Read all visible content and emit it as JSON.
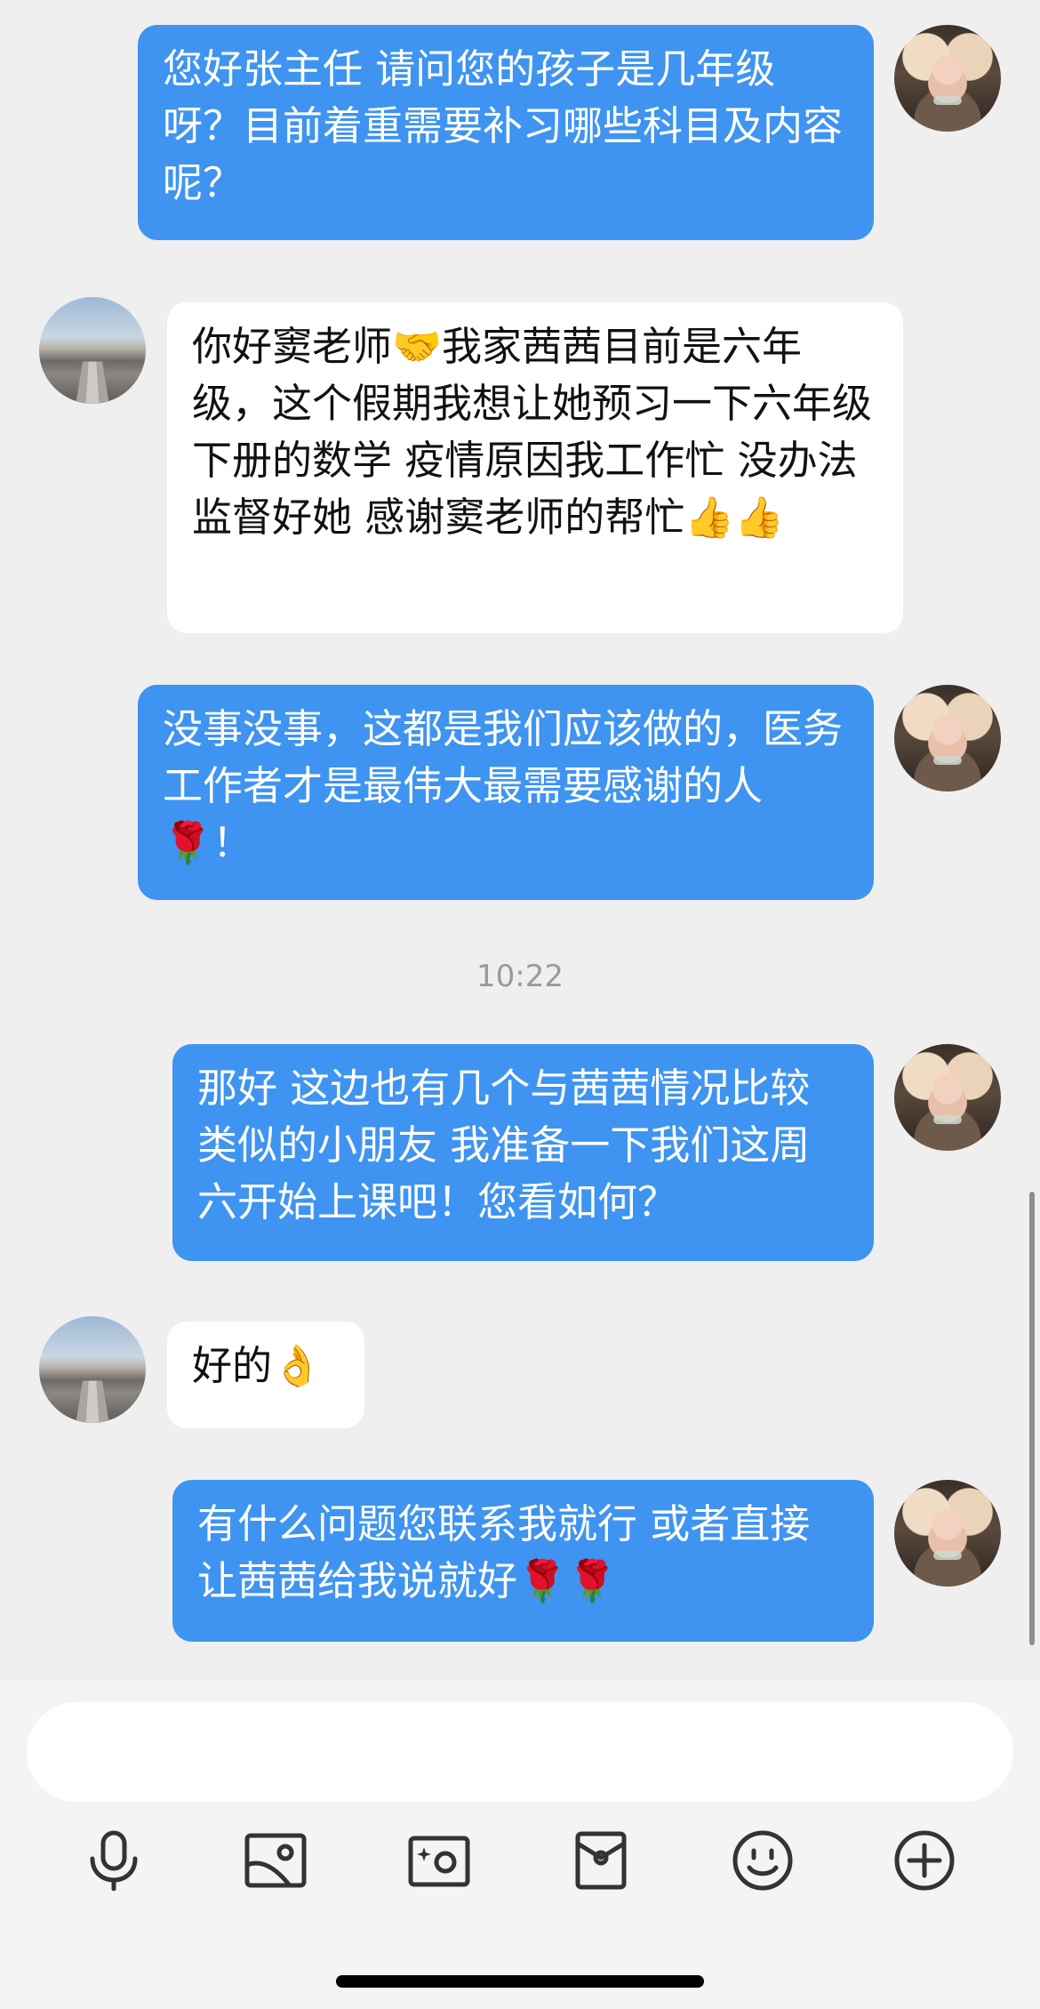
{
  "messages": [
    {
      "sender": "teacher",
      "text": "您好张主任 请问您的孩子是几年级呀？目前着重需要补习哪些科目及内容呢？"
    },
    {
      "sender": "parent",
      "text": "你好窦老师🤝我家茜茜目前是六年级，这个假期我想让她预习一下六年级下册的数学 疫情原因我工作忙 没办法监督好她 感谢窦老师的帮忙👍👍"
    },
    {
      "sender": "teacher",
      "text": "没事没事，这都是我们应该做的，医务工作者才是最伟大最需要感谢的人🌹！"
    },
    {
      "sender": "teacher",
      "text": "那好 这边也有几个与茜茜情况比较类似的小朋友 我准备一下我们这周六开始上课吧！您看如何？"
    },
    {
      "sender": "parent",
      "text": "好的👌"
    },
    {
      "sender": "teacher",
      "text": "有什么问题您联系我就行 或者直接让茜茜给我说就好🌹🌹"
    }
  ],
  "timestamp": "10:22",
  "composer": {
    "input_value": "",
    "tools": [
      "microphone-icon",
      "image-icon",
      "camera-icon",
      "red-packet-icon",
      "emoji-icon",
      "plus-icon"
    ]
  },
  "colors": {
    "outgoing_bubble": "#3e94f0",
    "incoming_bubble": "#ffffff",
    "background": "#efefef"
  }
}
